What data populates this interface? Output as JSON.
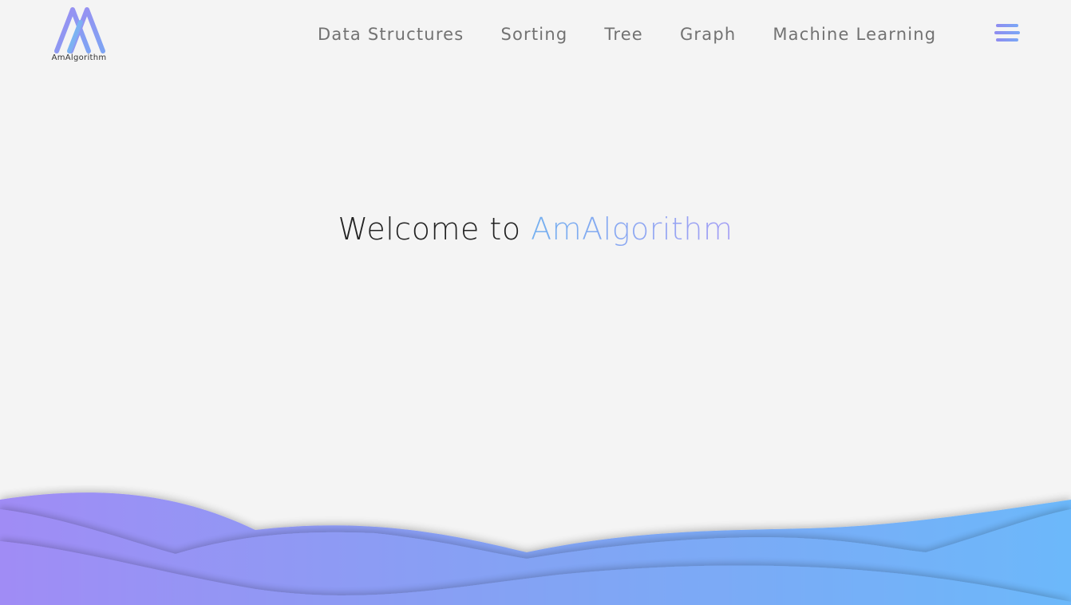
{
  "header": {
    "logo_label": "AmAlgorithm",
    "logo_icon": "double-a-logo-icon",
    "nav": [
      {
        "label": "Data Structures"
      },
      {
        "label": "Sorting"
      },
      {
        "label": "Tree"
      },
      {
        "label": "Graph"
      },
      {
        "label": "Machine Learning"
      }
    ],
    "menu_icon": "hamburger-menu-icon"
  },
  "hero": {
    "prefix": "Welcome to",
    "brand": "AmAlgorithm"
  },
  "colors": {
    "background": "#f4f4f4",
    "nav_text": "#727272",
    "accent_purple": "#a08cf5",
    "accent_blue": "#6cb8fa"
  }
}
